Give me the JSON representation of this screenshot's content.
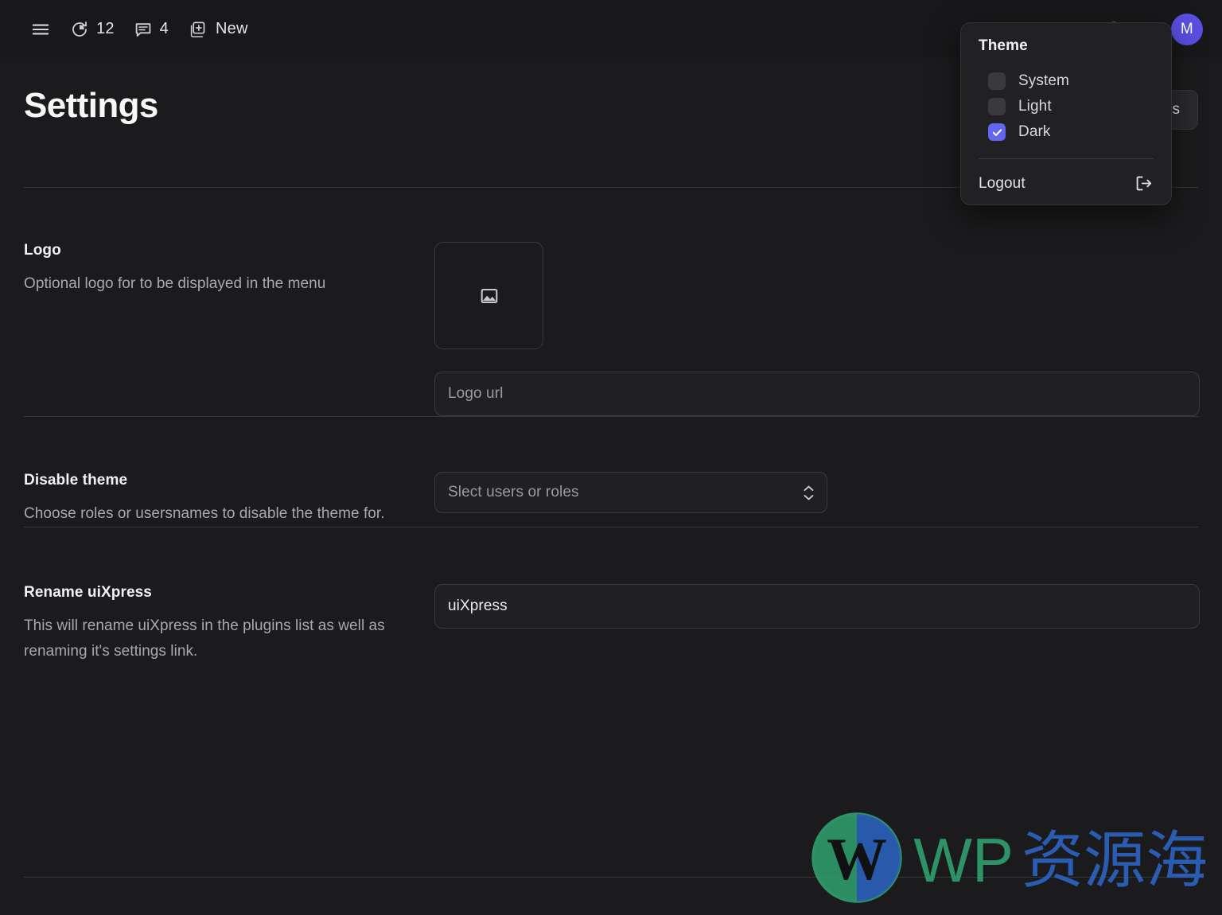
{
  "adminbar": {
    "menu_icon": "hamburger-menu-icon",
    "items": [
      {
        "icon": "updates-icon",
        "label": "12",
        "name": "updates"
      },
      {
        "icon": "comments-icon",
        "label": "4",
        "name": "comments"
      },
      {
        "icon": "new-content-icon",
        "label": "New",
        "name": "new"
      }
    ],
    "avatar_initial": "M",
    "avatar_color": "#5b4ee0"
  },
  "user_menu": {
    "title": "Theme",
    "options": [
      {
        "label": "System",
        "checked": false
      },
      {
        "label": "Light",
        "checked": false
      },
      {
        "label": "Dark",
        "checked": true
      }
    ],
    "logout_label": "Logout",
    "accent_color": "#6366f1"
  },
  "header": {
    "title": "Settings",
    "save_label": "Save changes"
  },
  "settings": {
    "rows": [
      {
        "title": "Logo",
        "description": "Optional logo for to be displayed in the menu",
        "control": "logo-uploader",
        "upload_icon": "image-placeholder-icon",
        "url_value": "",
        "url_placeholder": "Logo url"
      },
      {
        "title": "Disable theme",
        "description": "Choose roles or usersnames to disable the theme for.",
        "control": "select",
        "select_value": "Slect users or roles"
      },
      {
        "title": "Rename uiXpress",
        "description": "This will rename uiXpress in the plugins list as well as renaming it's settings link.",
        "control": "text",
        "text_value": "uiXpress",
        "text_placeholder": "uiXpress"
      }
    ]
  },
  "watermark": {
    "logo_icon": "wordpress-logo-icon",
    "text_latin": "WP",
    "text_cjk": "资源海",
    "color_green": "#2f9e6e",
    "color_blue": "#2b62bf"
  },
  "theme": {
    "background": "#1b1b1d",
    "topbar_background": "#18181a",
    "border": "#37373a"
  }
}
